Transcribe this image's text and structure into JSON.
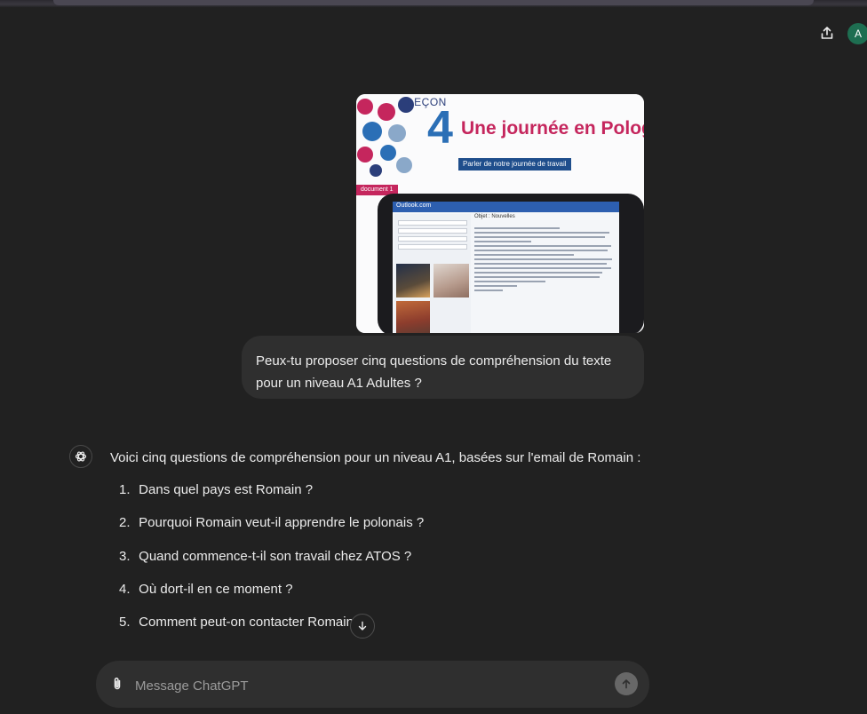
{
  "header": {
    "share_icon": "share-icon",
    "avatar_initial": "A"
  },
  "attachment": {
    "lesson_label": "LEÇON",
    "lesson_number": "4",
    "lesson_title": "Une journée en Pologne",
    "lesson_subtitle": "Parler de notre journée de travail",
    "document_tag": "document 1",
    "app_label": "Outlook.com",
    "email_subject": "Objet : Nouvelles"
  },
  "user_message": "Peux-tu proposer cinq questions de compréhension du texte pour un niveau A1 Adultes ?",
  "assistant": {
    "icon": "openai-logo-icon",
    "intro": "Voici cinq questions de compréhension pour un niveau A1, basées sur l'email de Romain :",
    "questions": [
      {
        "num": "1.",
        "text": "Dans quel pays est Romain ?"
      },
      {
        "num": "2.",
        "text": "Pourquoi Romain veut-il apprendre le polonais ?"
      },
      {
        "num": "3.",
        "text": "Quand commence-t-il son travail chez ATOS ?"
      },
      {
        "num": "4.",
        "text": "Où dort-il en ce moment ?"
      },
      {
        "num": "5.",
        "text": "Comment peut-on contacter Romain ?"
      }
    ]
  },
  "composer": {
    "placeholder": "Message ChatGPT"
  },
  "colors": {
    "background": "#212121",
    "bubble": "#2f2f2f",
    "avatar": "#1e6e51",
    "lesson_blue": "#2b6fb6",
    "lesson_pink": "#c5265d"
  }
}
